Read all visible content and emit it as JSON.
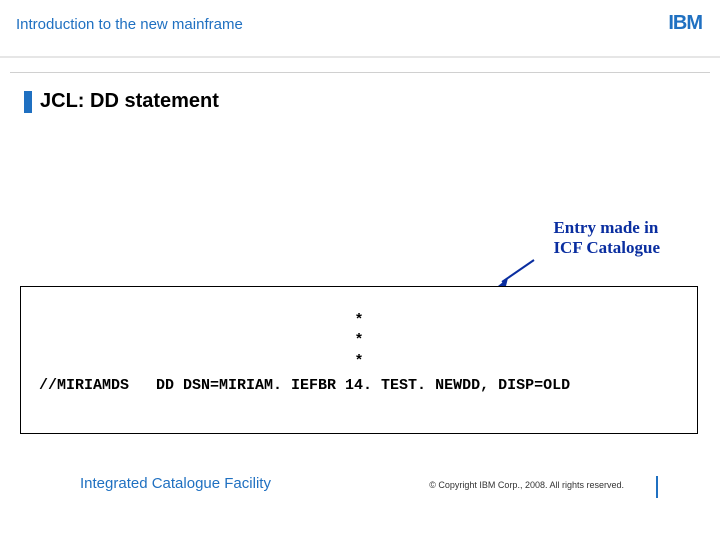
{
  "header": {
    "subtitle": "Introduction to the new mainframe",
    "logo_text": "IBM"
  },
  "title": "JCL: DD statement",
  "annotation": {
    "line1": "Entry made in",
    "line2": "ICF Catalogue"
  },
  "code": {
    "ast1": "*",
    "ast2": "*",
    "ast3": "*",
    "line": "//MIRIAMDS   DD DSN=MIRIAM. IEFBR 14. TEST. NEWDD, DISP=OLD"
  },
  "footer": {
    "note": "Integrated Catalogue Facility",
    "copyright": "© Copyright IBM Corp., 2008. All rights reserved."
  }
}
